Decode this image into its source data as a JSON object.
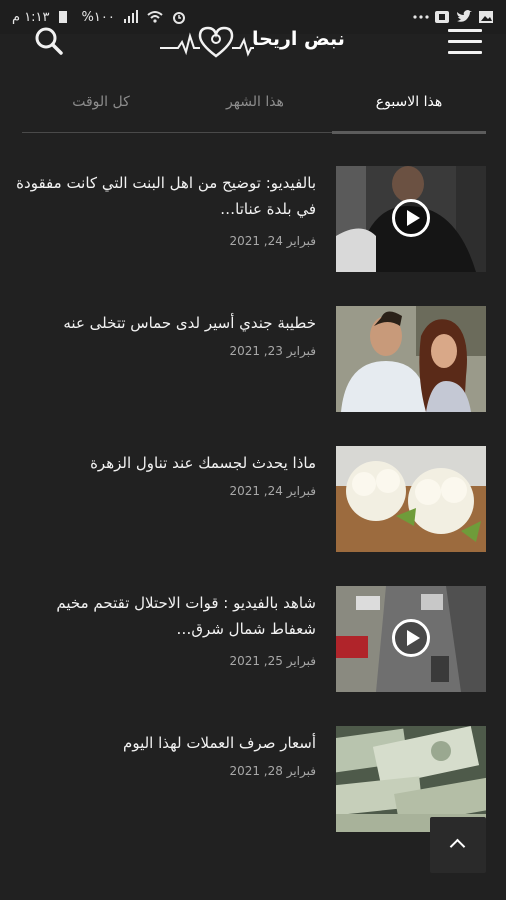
{
  "status_bar": {
    "time": "١:١٣ م",
    "battery": "%١٠٠",
    "icons": [
      "wifi-icon",
      "signal-icon",
      "alarm-icon",
      "more-icon",
      "gallery-icon",
      "twitter-icon",
      "box-icon"
    ]
  },
  "header": {
    "logo_text": "نبض اريحا",
    "icons": [
      "menu-icon",
      "search-icon",
      "heartbeat-logo-icon"
    ]
  },
  "tabs": [
    {
      "label": "هذا الاسبوع",
      "active": true
    },
    {
      "label": "هذا الشهر",
      "active": false
    },
    {
      "label": "كل الوقت",
      "active": false
    }
  ],
  "articles": [
    {
      "title": "بالفيديو: توضيح من اهل البنت التي كانت مفقودة في بلدة عناتا…",
      "date": "فبراير 24, 2021",
      "has_video": true
    },
    {
      "title": "خطيبة جندي أسير لدى حماس تتخلى عنه",
      "date": "فبراير 23, 2021",
      "has_video": false
    },
    {
      "title": "ماذا يحدث لجسمك عند تناول الزهرة",
      "date": "فبراير 24, 2021",
      "has_video": false
    },
    {
      "title": "شاهد بالفيديو : قوات الاحتلال تقتحم مخيم شعفاط شمال شرق…",
      "date": "فبراير 25, 2021",
      "has_video": true
    },
    {
      "title": "أسعار صرف العملات لهذا اليوم",
      "date": "فبراير 28, 2021",
      "has_video": false
    }
  ],
  "colors": {
    "background": "#212121",
    "text": "#f2f2f2",
    "muted": "#8c8c8c"
  }
}
